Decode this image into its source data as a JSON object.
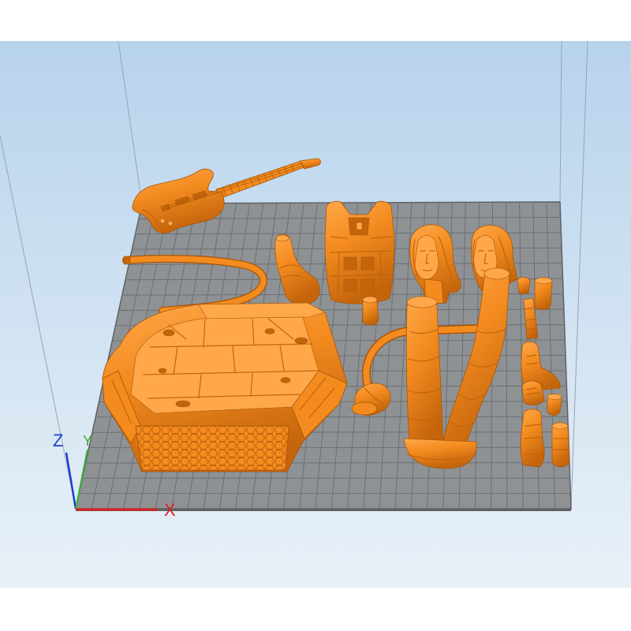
{
  "viewport": {
    "background_top": "#b7d3ec",
    "background_bottom": "#e9f1f8",
    "frame_color": "#ffffff",
    "volume_line_color": "#9aa4ad"
  },
  "build_plate": {
    "fill_color": "#8f9295",
    "grid_color": "#6c6f72",
    "edge_color": "#5f6265"
  },
  "models": {
    "fill_color": "#f38b1f",
    "light_color": "#ffa84a",
    "shade_color": "#c4650c",
    "outline_color": "#a85508"
  },
  "axes": {
    "z_label": "Z",
    "y_label": "Y",
    "x_label": "X",
    "z_color": "#1c3fd0",
    "y_color": "#34b534",
    "x_color": "#d92020"
  }
}
